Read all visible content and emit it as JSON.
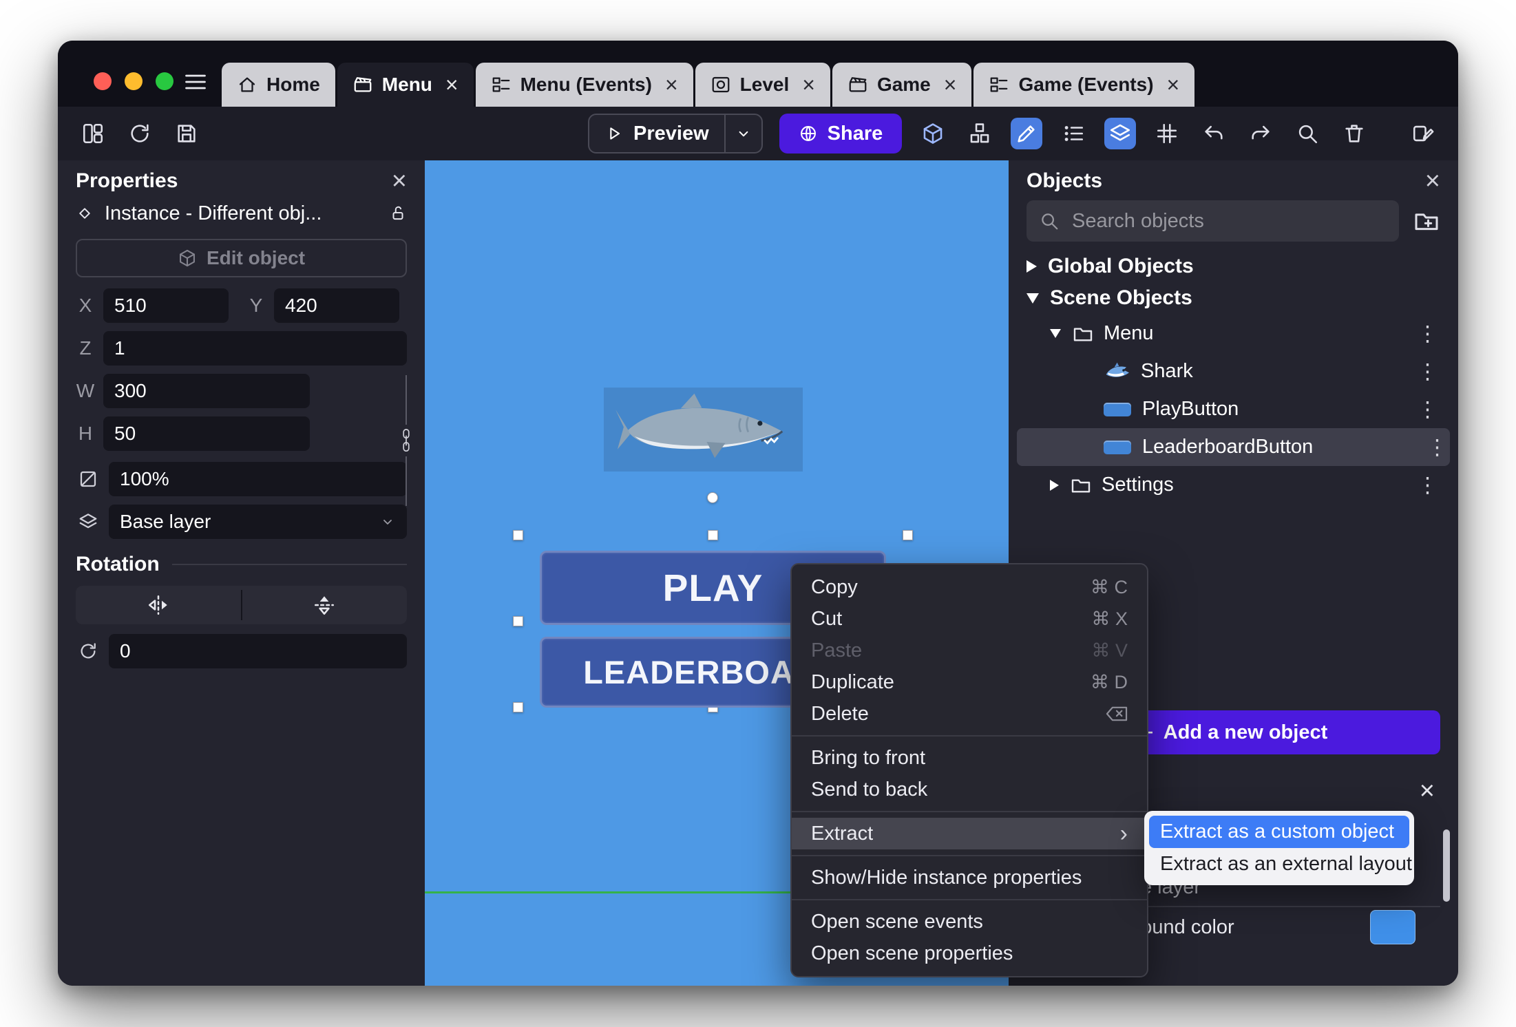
{
  "colors": {
    "accent_purple": "#4B1ADE",
    "canvas_blue": "#4E99E5",
    "submenu_selection_blue": "#3D7CF6",
    "background_color_swatch": "#3F8FE8",
    "scene_border_green": "#35B24A"
  },
  "titlebar": {
    "tabs": [
      {
        "label": "Home",
        "icon": "home-icon"
      },
      {
        "label": "Menu",
        "icon": "scene-icon",
        "close": "×",
        "active": true
      },
      {
        "label": "Menu (Events)",
        "icon": "events-icon",
        "close": "×"
      },
      {
        "label": "Level",
        "icon": "level-icon",
        "close": "×"
      },
      {
        "label": "Game",
        "icon": "scene-icon",
        "close": "×"
      },
      {
        "label": "Game (Events)",
        "icon": "events-icon",
        "close": "×"
      }
    ]
  },
  "toolbar": {
    "preview_label": "Preview",
    "share_label": "Share",
    "left_icons": [
      "panels-icon",
      "history-icon",
      "save-icon"
    ],
    "right_icons": [
      "cube-3d-icon",
      "objects-cubes-icon",
      "pencil-icon",
      "instances-list-icon",
      "layers-icon",
      "grid-icon",
      "undo-icon",
      "redo-icon",
      "zoom-icon",
      "trash-icon",
      "edit-properties-icon"
    ]
  },
  "properties": {
    "title": "Properties",
    "instance_label": "Instance  -  Different obj...",
    "edit_object_label": "Edit object",
    "x_label": "X",
    "x_value": "510",
    "y_label": "Y",
    "y_value": "420",
    "z_label": "Z",
    "z_value": "1",
    "w_label": "W",
    "w_value": "300",
    "h_label": "H",
    "h_value": "50",
    "opacity_value": "100%",
    "layer_value": "Base layer",
    "rotation_title": "Rotation",
    "rotation_value": "0"
  },
  "canvas": {
    "play_label": "PLAY",
    "leaderboard_label": "LEADERBOARD"
  },
  "context_menu": {
    "items": [
      {
        "label": "Copy",
        "shortcut": "⌘ C"
      },
      {
        "label": "Cut",
        "shortcut": "⌘ X"
      },
      {
        "label": "Paste",
        "shortcut": "⌘ V",
        "disabled": true
      },
      {
        "label": "Duplicate",
        "shortcut": "⌘ D"
      },
      {
        "label": "Delete",
        "shortcut_icon": "delete-key-icon"
      },
      {
        "separator": true
      },
      {
        "label": "Bring to front"
      },
      {
        "label": "Send to back"
      },
      {
        "separator": true
      },
      {
        "label": "Extract",
        "submenu": true,
        "highlighted": true
      },
      {
        "separator": true
      },
      {
        "label": "Show/Hide instance properties"
      },
      {
        "separator": true
      },
      {
        "label": "Open scene events"
      },
      {
        "label": "Open scene properties"
      }
    ],
    "submenu": [
      {
        "label": "Extract as a custom object",
        "highlighted": true
      },
      {
        "label": "Extract as an external layout"
      }
    ]
  },
  "objects": {
    "title": "Objects",
    "search_placeholder": "Search objects",
    "global_section": "Global Objects",
    "scene_section": "Scene Objects",
    "tree": [
      {
        "label": "Menu",
        "type": "folder",
        "expanded": true
      },
      {
        "label": "Shark",
        "type": "object",
        "icon": "shark-icon"
      },
      {
        "label": "PlayButton",
        "type": "object",
        "icon": "button-icon"
      },
      {
        "label": "LeaderboardButton",
        "type": "object",
        "icon": "button-icon",
        "selected": true
      },
      {
        "label": "Settings",
        "type": "folder",
        "expanded": false
      }
    ],
    "add_button_label": "Add a new object"
  },
  "layers_panel": {
    "layer_label": "Base layer",
    "color_label": "Background color"
  }
}
